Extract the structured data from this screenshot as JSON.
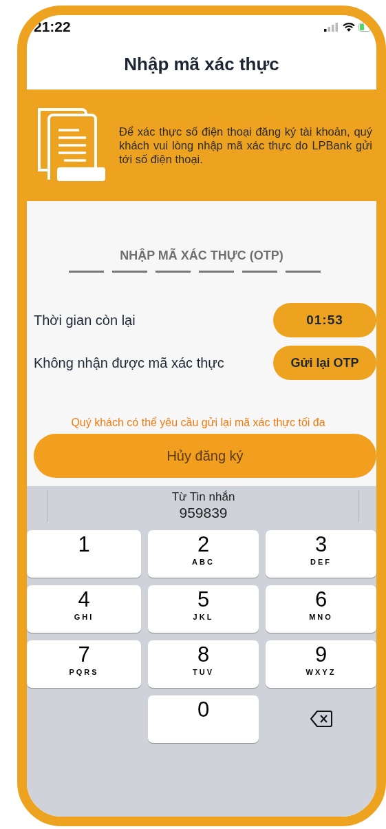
{
  "status_bar": {
    "time": "21:22"
  },
  "title": "Nhập mã xác thực",
  "banner": {
    "text": "Để xác thực số điện thoại đăng ký tài khoản, quý khách vui lòng nhập mã xác thực do LPBank gửi tới số điện thoại."
  },
  "otp": {
    "label": "NHẬP MÃ XÁC THỰC (OTP)",
    "slots": [
      {
        "filled": false
      },
      {
        "filled": false
      },
      {
        "filled": false
      },
      {
        "filled": false
      },
      {
        "filled": false
      },
      {
        "filled": false
      }
    ]
  },
  "rows": [
    {
      "label": "Thời gian còn lại",
      "value": "01:53",
      "kind": "timer"
    },
    {
      "label": "Không nhận được mã xác thực",
      "value": "Gửi lại OTP",
      "kind": "button"
    }
  ],
  "notice": "Quý khách có thể yêu cầu gửi lại mã xác thực tối đa",
  "cancel_button": "Hủy đăng ký",
  "keyboard": {
    "suggestion": {
      "source": "Từ Tin nhắn",
      "code": "959839"
    },
    "rows": [
      [
        {
          "kind": "digit",
          "digit": "1"
        },
        {
          "kind": "digit",
          "digit": "2",
          "letters": "ABC"
        },
        {
          "kind": "digit",
          "digit": "3",
          "letters": "DEF"
        }
      ],
      [
        {
          "kind": "digit",
          "digit": "4",
          "letters": "GHI"
        },
        {
          "kind": "digit",
          "digit": "5",
          "letters": "JKL"
        },
        {
          "kind": "digit",
          "digit": "6",
          "letters": "MNO"
        }
      ],
      [
        {
          "kind": "digit",
          "digit": "7",
          "letters": "PQRS"
        },
        {
          "kind": "digit",
          "digit": "8",
          "letters": "TUV"
        },
        {
          "kind": "digit",
          "digit": "9",
          "letters": "WXYZ"
        }
      ],
      [
        {
          "kind": "empty"
        },
        {
          "kind": "digit",
          "digit": "0"
        },
        {
          "kind": "delete"
        }
      ]
    ]
  }
}
